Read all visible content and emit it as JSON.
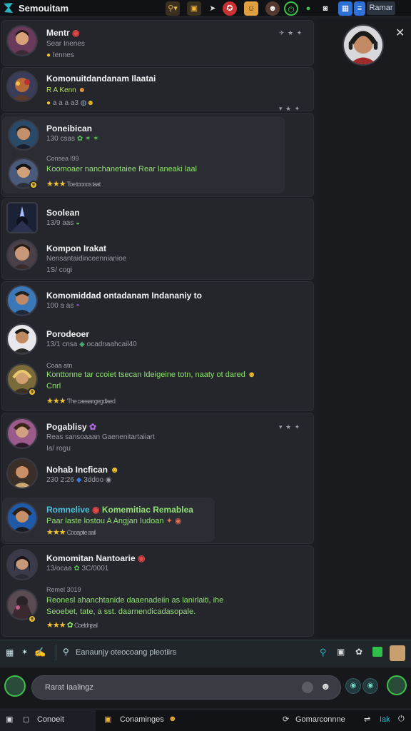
{
  "app": {
    "title": "Semouitam",
    "top_button": "Ramar",
    "icons": [
      "app-logo-icon",
      "search-filter-icon",
      "folder-icon",
      "share-icon",
      "alert-icon",
      "game-icon",
      "profile-icon",
      "status-icon",
      "chat-bubble-icon",
      "camera-icon",
      "store-icon",
      "more-icon"
    ],
    "accent": "#2bb3c0"
  },
  "feed": [
    {
      "name": "Mentr",
      "meta": "Sear Inenes",
      "sub": "Iennes",
      "badges": "✈ ★ ✦"
    },
    {
      "name": "Komonuitdandanam Ilaatai",
      "meta": "R A Kenn",
      "sub": "a a a a3",
      "extra": "ǝ"
    },
    {
      "name": "Poneibican",
      "meta": "130 csas",
      "note": "Consea l99",
      "green": "Koomoaer nanchanetaiee Rear laneaki laal",
      "stars": "★★★",
      "star_meta": "Toe toooos taat"
    },
    {
      "name": "Soolean",
      "meta": "13/9 aas"
    },
    {
      "name": "Kompon Irakat",
      "meta": "Nensantaidinceennianioe",
      "sub": "1S/ cogi"
    },
    {
      "name": "Komomiddad ontadanam Indananiy to",
      "meta": "100 a as"
    },
    {
      "name": "Porodeoer",
      "meta": "13/1 cnsa",
      "meta2": "ocadnaahcail40",
      "note": "Coaa atn",
      "green": "Konttonne tar ccoiet tsecan Ideigeine totn, naaty ot dared",
      "green2": "Cnrl",
      "stars": "★★★",
      "star_meta": "'The caeaangegdlaed"
    },
    {
      "name": "Pogablisy",
      "meta": "Reas sansoaaan Gaenenitartaiiart",
      "sub": "Ia/ rogu"
    },
    {
      "name": "Nohab Incfican",
      "meta": "230 2:26",
      "meta2": "3ddoo"
    },
    {
      "name": "Romnelive",
      "name2": "Komemitiac Remablea",
      "green": "Paar laste lostou A Angjan Iudoan",
      "stars": "★★★",
      "star_meta": "Cooaptie aail"
    },
    {
      "name": "Komomitan Nantoarie",
      "meta": "13/ocaa",
      "meta2": "3C/0001",
      "note": "Remel 3019",
      "green": "Reonesl ahanchtanide daaenadeiin as lanirlaiti, ihe",
      "green2": "Seoebet, tate, a sst. daarnendicadasopale.",
      "stars": "★★★",
      "star_meta": "Coeldnjsal"
    }
  ],
  "search": {
    "text": "Eanaunjy oteocoang pleotiirs"
  },
  "composer": {
    "placeholder": "Rarat Iaalingz"
  },
  "bottom_nav": {
    "left": "Conoeit",
    "center": "Conaminges",
    "right": "Gomarconnne",
    "far_right": "Iak"
  }
}
